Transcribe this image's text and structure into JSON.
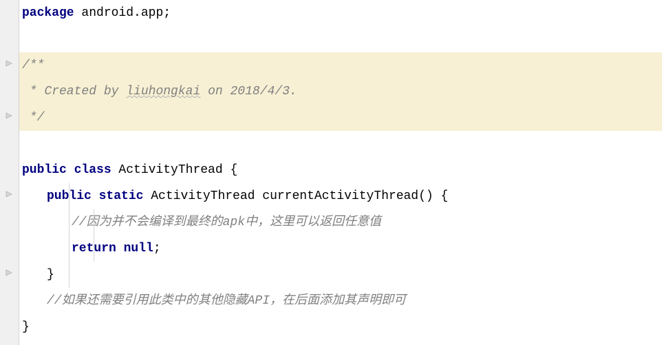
{
  "code": {
    "l1": {
      "kw_package": "package",
      "pkg": " android.app",
      "semi": ";"
    },
    "l3": {
      "jd_open": "/**"
    },
    "l4": {
      "jd_body": " * Created by liuhongkai on 2018/4/3."
    },
    "l5": {
      "jd_close": " */"
    },
    "l7": {
      "kw_public": "public",
      "kw_class": " class",
      "name": " ActivityThread ",
      "brace": "{"
    },
    "l8": {
      "kw_public": "public",
      "kw_static": " static",
      "ret": " ActivityThread ",
      "method": "currentActivityThread",
      "paren": "() ",
      "brace": "{"
    },
    "l9": {
      "comment": "//因为并不会编译到最终的apk中，这里可以返回任意值"
    },
    "l10": {
      "kw_return": "return",
      "kw_null": " null",
      "semi": ";"
    },
    "l11": {
      "brace": "}"
    },
    "l12": {
      "comment": "//如果还需要引用此类中的其他隐藏API，在后面添加其声明即可"
    },
    "l13": {
      "brace": "}"
    },
    "wavy_word": "liuhongkai"
  }
}
